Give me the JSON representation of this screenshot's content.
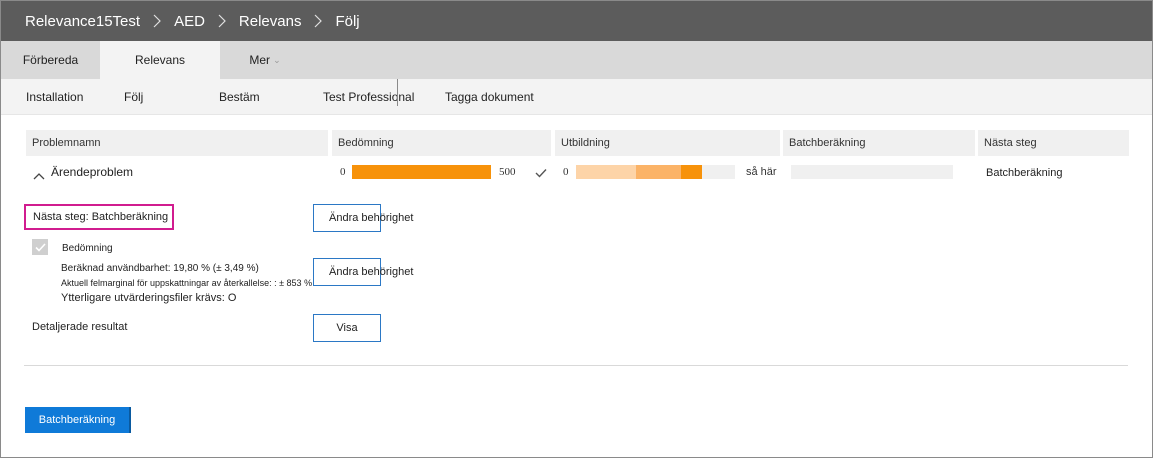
{
  "breadcrumb": [
    "Relevance15Test",
    "AED",
    "Relevans",
    "Följ"
  ],
  "tabs": [
    "Förbereda",
    "Relevans",
    "Mer"
  ],
  "subnav": [
    "Installation",
    "Följ",
    "Bestäm",
    "Test Professional",
    "Tagga dokument"
  ],
  "table": {
    "headers": [
      "Problemnamn",
      "Bedömning",
      "Utbildning",
      "Batchberäkning",
      "Nästa steg"
    ],
    "row": {
      "issue": "Ärendeproblem",
      "assessment_min": "0",
      "assessment_max": "500",
      "training_min": "0",
      "training_status": "så här",
      "next_step": "Batchberäkning"
    }
  },
  "next_step_label": "Nästa steg: Batchberäkning",
  "change_permission_label": "Ändra behörighet",
  "assessment": {
    "label": "Bedömning",
    "estimated_usability": "Beräknad användbarhet: 19,80 % (± 3,49 %)",
    "margin_of_error": "Aktuell felmarginal för uppskattningar av återkallelse: : ± 853 %",
    "additional_files": "Ytterligare utvärderingsfiler krävs: O"
  },
  "detailed_results": "Detaljerade resultat",
  "show_label": "Visa",
  "primary_button": "Batchberäkning",
  "colors": {
    "header_bg": "#5c5c5c",
    "orange": "#f7920a",
    "orange_light": "#fdd4a8",
    "orange_mid": "#fbb367",
    "accent_blue": "#0f7ad8",
    "highlight_pink": "#d11c8f"
  },
  "progress": {
    "assessment_fill": 1.0,
    "training_segments": [
      0.38,
      0.28,
      0.13
    ]
  }
}
